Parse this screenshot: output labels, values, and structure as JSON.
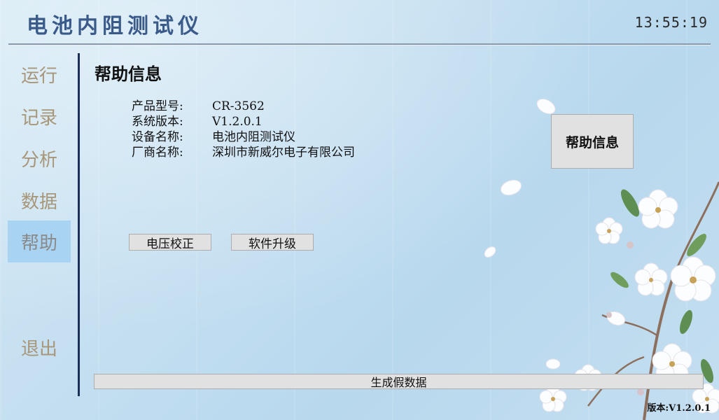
{
  "app_title": "电池内阻测试仪",
  "clock": "13:55:19",
  "nav": {
    "items": [
      {
        "key": "run",
        "label": "运行"
      },
      {
        "key": "record",
        "label": "记录"
      },
      {
        "key": "analysis",
        "label": "分析"
      },
      {
        "key": "data",
        "label": "数据"
      },
      {
        "key": "help",
        "label": "帮助"
      }
    ],
    "exit_label": "退出",
    "active": "help"
  },
  "page": {
    "title": "帮助信息",
    "info": [
      {
        "label": "产品型号:",
        "value": "CR-3562"
      },
      {
        "label": "系统版本:",
        "value": "V1.2.0.1"
      },
      {
        "label": "设备名称:",
        "value": "电池内阻测试仪"
      },
      {
        "label": "厂商名称:",
        "value": "深圳市新威尔电子有限公司"
      }
    ],
    "help_button": "帮助信息",
    "voltage_calibration_button": "电压校正",
    "software_upgrade_button": "软件升级",
    "generate_fake_data_button": "生成假数据"
  },
  "footer": {
    "version": "版本:V1.2.0.1"
  },
  "colors": {
    "nav_active_bg": "#a9d3f3",
    "nav_text": "#a8967a",
    "divider": "#1c2f5a",
    "title_color": "#3a5a8a"
  },
  "icons": [
    "flower-decoration"
  ]
}
